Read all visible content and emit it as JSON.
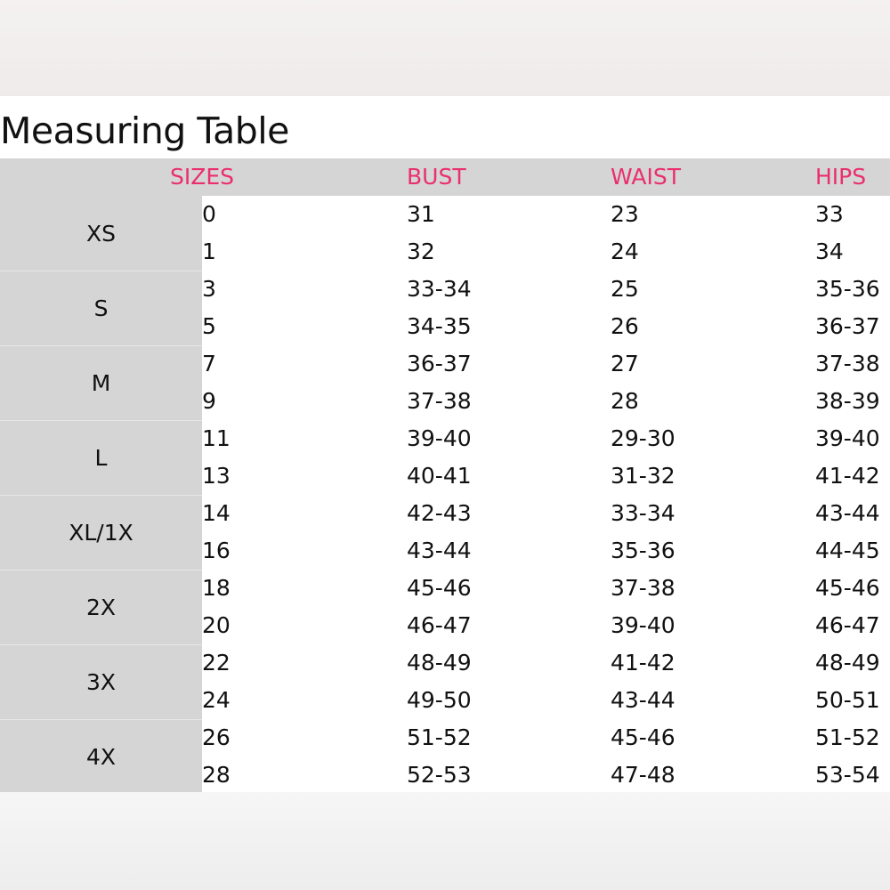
{
  "title": "Measuring Table",
  "colors": {
    "header_text": "#ea2e6e",
    "header_bg": "#d5d5d5",
    "body_text": "#111111"
  },
  "columns": {
    "sizes": "SIZES",
    "bust": "BUST",
    "waist": "WAIST",
    "hips": "HIPS"
  },
  "groups": [
    {
      "label": "XS",
      "rows": [
        {
          "num": "0",
          "bust": "31",
          "waist": "23",
          "hips": "33"
        },
        {
          "num": "1",
          "bust": "32",
          "waist": "24",
          "hips": "34"
        }
      ]
    },
    {
      "label": "S",
      "rows": [
        {
          "num": "3",
          "bust": "33-34",
          "waist": "25",
          "hips": "35-36"
        },
        {
          "num": "5",
          "bust": "34-35",
          "waist": "26",
          "hips": "36-37"
        }
      ]
    },
    {
      "label": "M",
      "rows": [
        {
          "num": "7",
          "bust": "36-37",
          "waist": "27",
          "hips": "37-38"
        },
        {
          "num": "9",
          "bust": "37-38",
          "waist": "28",
          "hips": "38-39"
        }
      ]
    },
    {
      "label": "L",
      "rows": [
        {
          "num": "11",
          "bust": "39-40",
          "waist": "29-30",
          "hips": "39-40"
        },
        {
          "num": "13",
          "bust": "40-41",
          "waist": "31-32",
          "hips": "41-42"
        }
      ]
    },
    {
      "label": "XL/1X",
      "rows": [
        {
          "num": "14",
          "bust": "42-43",
          "waist": "33-34",
          "hips": "43-44"
        },
        {
          "num": "16",
          "bust": "43-44",
          "waist": "35-36",
          "hips": "44-45"
        }
      ]
    },
    {
      "label": "2X",
      "rows": [
        {
          "num": "18",
          "bust": "45-46",
          "waist": "37-38",
          "hips": "45-46"
        },
        {
          "num": "20",
          "bust": "46-47",
          "waist": "39-40",
          "hips": "46-47"
        }
      ]
    },
    {
      "label": "3X",
      "rows": [
        {
          "num": "22",
          "bust": "48-49",
          "waist": "41-42",
          "hips": "48-49"
        },
        {
          "num": "24",
          "bust": "49-50",
          "waist": "43-44",
          "hips": "50-51"
        }
      ]
    },
    {
      "label": "4X",
      "rows": [
        {
          "num": "26",
          "bust": "51-52",
          "waist": "45-46",
          "hips": "51-52"
        },
        {
          "num": "28",
          "bust": "52-53",
          "waist": "47-48",
          "hips": "53-54"
        }
      ]
    }
  ]
}
